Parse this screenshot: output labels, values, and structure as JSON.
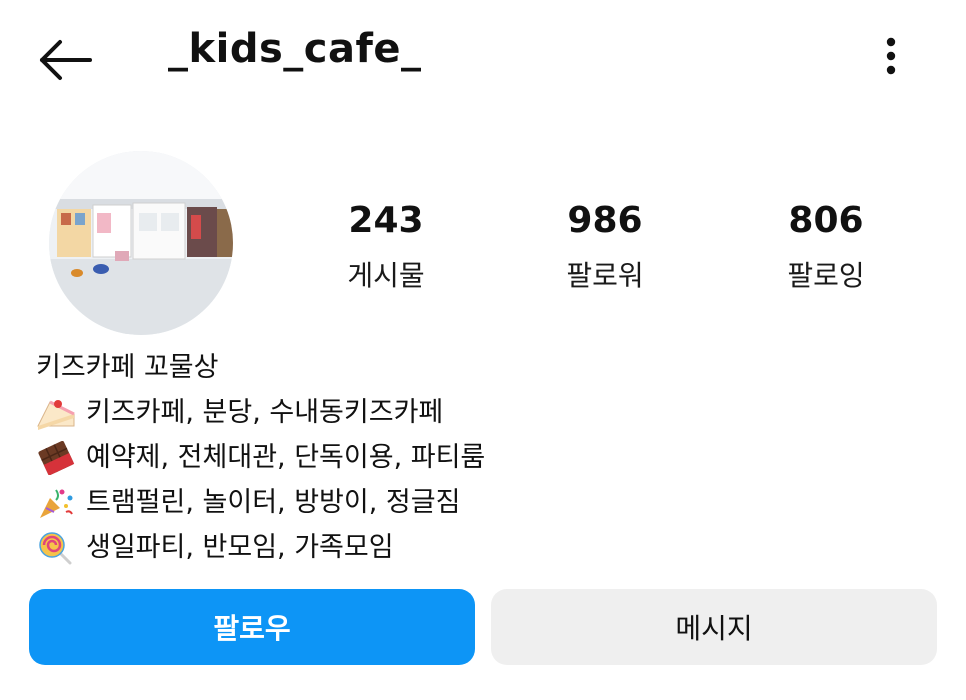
{
  "header": {
    "username": "_kids_cafe_",
    "back_icon": "back-arrow-icon",
    "more_icon": "more-vertical-icon"
  },
  "profile": {
    "stats": [
      {
        "value": "243",
        "label": "게시물"
      },
      {
        "value": "986",
        "label": "팔로워"
      },
      {
        "value": "806",
        "label": "팔로잉"
      }
    ],
    "bio": {
      "name": "키즈카페 꼬물상",
      "lines": [
        {
          "icon": "cake-icon",
          "text": "키즈카페, 분당, 수내동키즈카페"
        },
        {
          "icon": "chocolate-icon",
          "text": "예약제, 전체대관, 단독이용, 파티룸"
        },
        {
          "icon": "party-popper-icon",
          "text": "트램펄린, 놀이터, 방방이, 정글짐"
        },
        {
          "icon": "lollipop-icon",
          "text": "생일파티, 반모임, 가족모임"
        }
      ]
    }
  },
  "actions": {
    "follow_label": "팔로우",
    "message_label": "메시지"
  },
  "colors": {
    "follow_button": "#0d95f6",
    "message_button": "#efefef"
  }
}
